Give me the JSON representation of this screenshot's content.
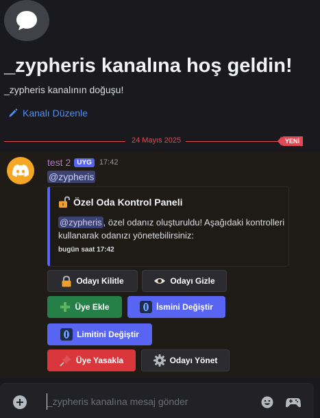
{
  "channel": {
    "welcome_title": "_zypheris kanalına hoş geldin!",
    "welcome_subtitle": "_zypheris kanalının doğuşu!",
    "edit_link": "Kanalı Düzenle"
  },
  "divider": {
    "date": "24 Mayıs 2025",
    "new_badge": "YENİ"
  },
  "message": {
    "author": "test 2",
    "app_badge": "UYG",
    "timestamp": "17:42",
    "mention": "@zypheris",
    "embed": {
      "title": "Özel Oda Kontrol Paneli",
      "mention": "@zypheris",
      "description": ", özel odanız oluşturuldu! Aşağıdaki kontrolleri kullanarak odanızı yönetebilirsiniz:",
      "footer": "bugün saat 17:42"
    },
    "buttons": [
      {
        "label": "Odayı Kilitle",
        "style": "secondary",
        "icon": "lock-icon"
      },
      {
        "label": "Odayı Gizle",
        "style": "secondary",
        "icon": "eye-icon"
      },
      {
        "label": "Üye Ekle",
        "style": "success",
        "icon": "plus-icon"
      },
      {
        "label": "İsmini Değiştir",
        "style": "primary",
        "icon": "info-icon"
      },
      {
        "label": "Limitini Değiştir",
        "style": "primary",
        "icon": "info-icon"
      },
      {
        "label": "Üye Yasakla",
        "style": "danger",
        "icon": "pushpin-icon"
      },
      {
        "label": "Odayı Yönet",
        "style": "secondary",
        "icon": "gear-icon"
      }
    ]
  },
  "composer": {
    "placeholder": "_zypheris kanalına mesaj gönder"
  },
  "colors": {
    "accent": "#5865f2",
    "success": "#248046",
    "danger": "#da373c",
    "link": "#4f8ef7",
    "new_divider": "#e14a55"
  }
}
